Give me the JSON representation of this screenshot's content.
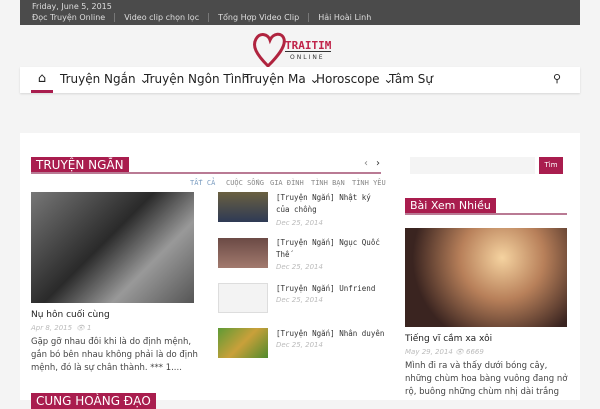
{
  "topbar": {
    "date": "Friday, June 5, 2015",
    "links": [
      "Đọc Truyện Online",
      "Video clip chọn lọc",
      "Tổng Hợp Video Clip",
      "Hải Hoài Linh"
    ]
  },
  "logo": {
    "line1": "TRAITIM",
    "line2": "ONLINE"
  },
  "nav": {
    "items": [
      "Truyện Ngắn ⌄",
      "Truyện Ngôn Tình",
      "Truyện Ma ⌄",
      "Horoscope ⌄",
      "Tâm Sự"
    ]
  },
  "section": {
    "title": "TRUYỆN NGẮN",
    "prev": "‹",
    "next": "›",
    "tabs": [
      "TẤT CẢ",
      "CUỘC SỐNG",
      "GIA ĐÌNH",
      "TÌNH BẠN",
      "TÌNH YÊU"
    ],
    "featured": {
      "title": "Nụ hôn cuối cùng",
      "date": "Apr 8, 2015",
      "views": "1",
      "excerpt": "Gặp gỡ nhau đôi khi là do định mệnh, gắn bó bên nhau không phải là do định mệnh, đó là sự chân thành. *** 1...."
    },
    "items": [
      {
        "title": "[Truyện Ngắn] Nhật ký của chồng",
        "date": "Dec 25, 2014"
      },
      {
        "title": "[Truyện Ngắn] Ngục Quốc Thế",
        "date": "Dec 25, 2014"
      },
      {
        "title": "[Truyện Ngắn] Unfriend",
        "date": "Dec 25, 2014"
      },
      {
        "title": "[Truyện Ngắn] Nhân duyên",
        "date": "Dec 25, 2014"
      }
    ]
  },
  "section2": {
    "title": "CUNG HOÀNG ĐẠO"
  },
  "sidebar": {
    "search_button": "Tìm",
    "search_placeholder": "",
    "popular_title": "Bài Xem Nhiều",
    "post": {
      "title": "Tiếng vĩ cầm xa xôi",
      "date": "May 29, 2014",
      "views": "6669",
      "excerpt": "Mình đi ra và thấy dưới bóng cây, những chùm hoa bàng vuông đang nở rộ, buông những chùm nhị dài trắng"
    }
  }
}
